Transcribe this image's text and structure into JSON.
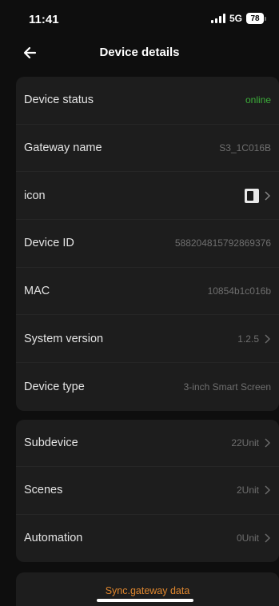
{
  "status_bar": {
    "time": "11:41",
    "network": "5G",
    "battery": "78"
  },
  "header": {
    "title": "Device details"
  },
  "details": [
    {
      "label": "Device status",
      "value": "online",
      "chevron": false,
      "type": "status"
    },
    {
      "label": "Gateway name",
      "value": "S3_1C016B",
      "chevron": false
    },
    {
      "label": "icon",
      "value": "",
      "chevron": true,
      "type": "icon"
    },
    {
      "label": "Device ID",
      "value": "588204815792869376",
      "chevron": false
    },
    {
      "label": "MAC",
      "value": "10854b1c016b",
      "chevron": false
    },
    {
      "label": "System version",
      "value": "1.2.5",
      "chevron": true
    },
    {
      "label": "Device type",
      "value": "3-inch Smart Screen",
      "chevron": false
    }
  ],
  "related": [
    {
      "label": "Subdevice",
      "value": "22Unit",
      "chevron": true
    },
    {
      "label": "Scenes",
      "value": "2Unit",
      "chevron": true
    },
    {
      "label": "Automation",
      "value": "0Unit",
      "chevron": true
    }
  ],
  "sync": {
    "label": "Sync.gateway data"
  },
  "colors": {
    "online": "#3cae3a",
    "accent": "#e0872e",
    "card": "#1d1d1d",
    "background": "#0e0e0e"
  }
}
